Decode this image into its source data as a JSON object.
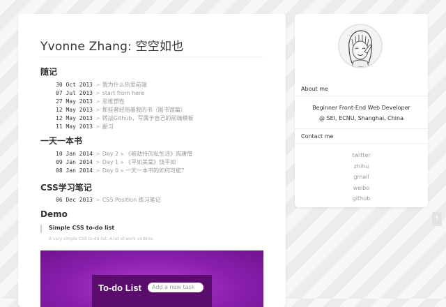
{
  "site_title": "Yvonne Zhang: 空空如也",
  "sections": {
    "notes": {
      "title": "随记",
      "posts": [
        {
          "date": "30 Oct 2013",
          "title": "我为什么热爱前端"
        },
        {
          "date": "07 Jul 2013",
          "title": "start from here"
        },
        {
          "date": "27 May 2013",
          "title": "思维惯性"
        },
        {
          "date": "12 May 2013",
          "title": "那些曾经陪着我的书（图书馆篇）"
        },
        {
          "date": "12 May 2013",
          "title": "转战Github，写属于自己的前端模板"
        },
        {
          "date": "11 May 2013",
          "title": "鄙习"
        }
      ]
    },
    "book": {
      "title": "一天一本书",
      "posts": [
        {
          "date": "10 Jan 2014",
          "title": "Day 2 » 《被劫持的私生活》肉唐僧"
        },
        {
          "date": "09 Jan 2014",
          "title": "Day 1 » 《平如美棠》饶平如"
        },
        {
          "date": "08 Jan 2014",
          "title": "Day 0 » 一天一本书的如何可能？"
        }
      ]
    },
    "css": {
      "title": "CSS学习笔记",
      "posts": [
        {
          "date": "06 Dec 2013",
          "title": "CSS Position 练习笔记"
        }
      ]
    },
    "demo": {
      "title": "Demo",
      "item_title": "Simple CSS to-do list",
      "item_desc": "A very simple CSS to-do list. A lot of work undone.",
      "preview_title": "To-do List",
      "preview_placeholder": "Add a new task"
    }
  },
  "sidebar": {
    "about_label": "About me",
    "about_line1": "Beginner Front-End Web Developer",
    "about_line2": "@ SEI, ECNU, Shanghai, China",
    "contact_label": "Contact me",
    "contacts": [
      "twitter",
      "zhihu",
      "gmail",
      "weibo",
      "github"
    ]
  },
  "back_to_top_icon": "arrow-up-icon",
  "back_to_top_glyph": "↑"
}
